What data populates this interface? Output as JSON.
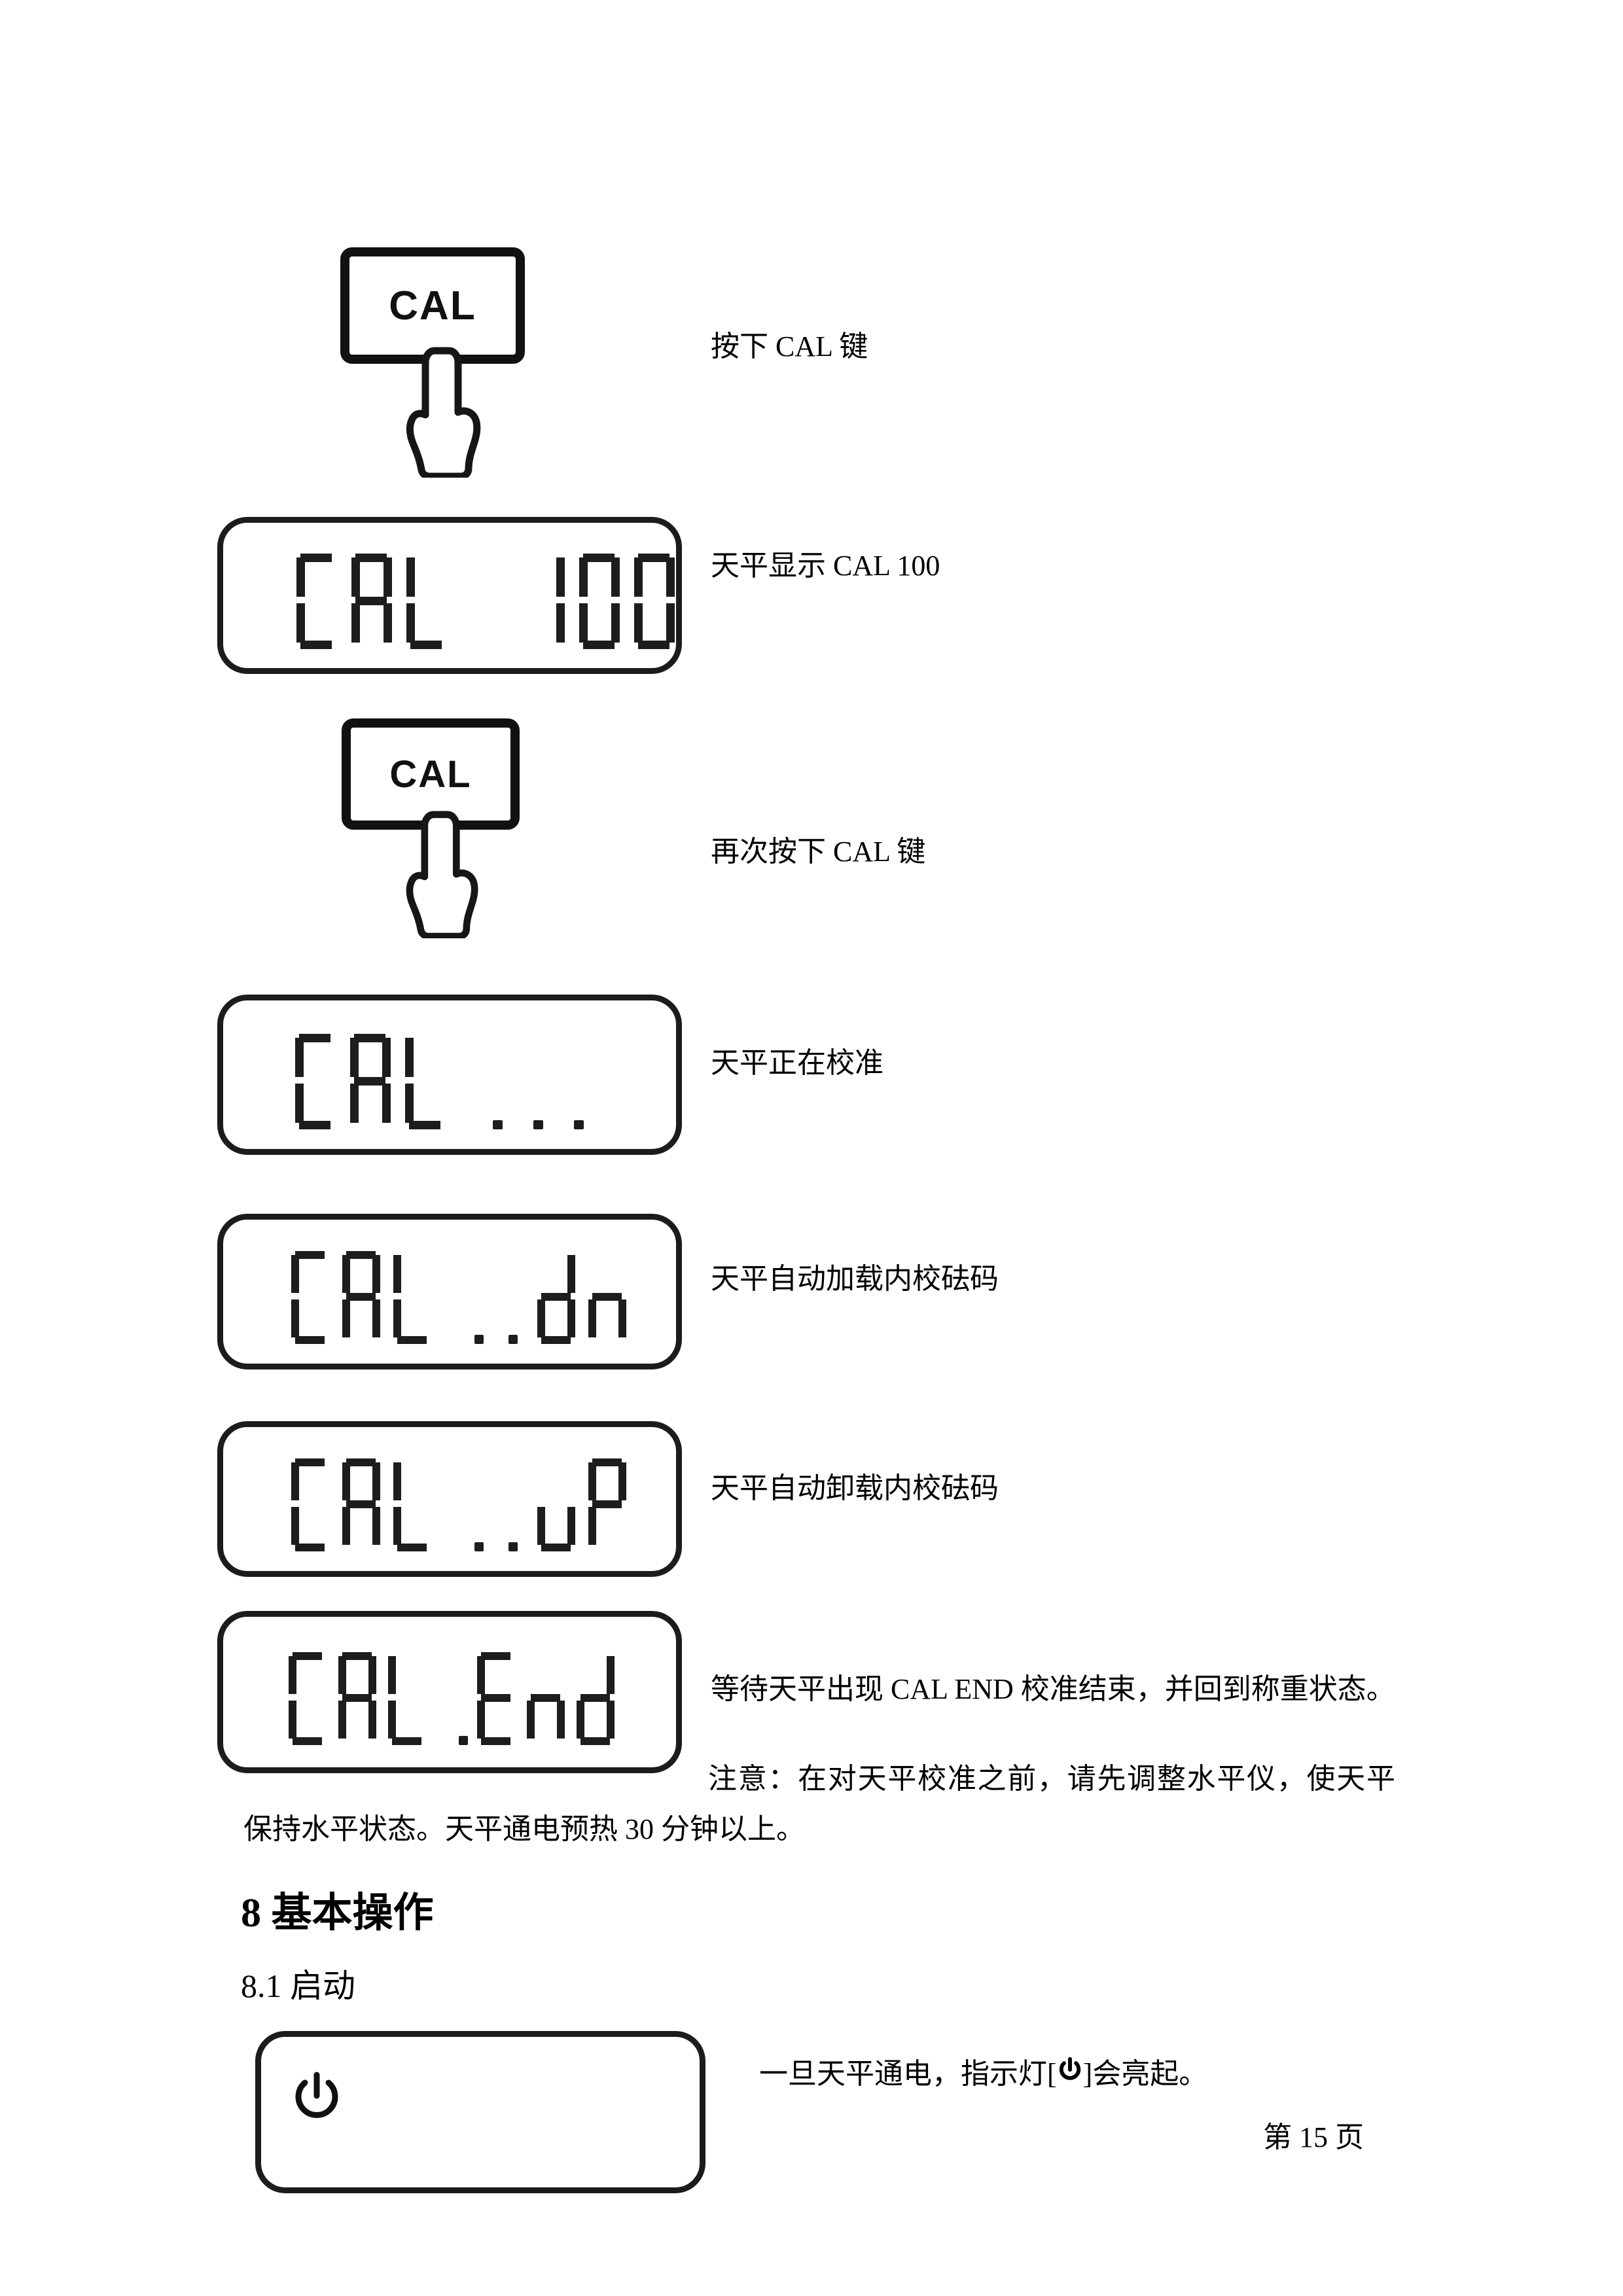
{
  "document": {
    "page_number_text": "第 15 页",
    "language": "zh-CN"
  },
  "steps": [
    {
      "id": "step-press-cal",
      "visual": "cal-key",
      "key_label": "CAL",
      "caption": "按下 CAL 键"
    },
    {
      "id": "step-display-cal-100",
      "visual": "lcd",
      "display_text": "CAL 100",
      "caption": "天平显示 CAL 100"
    },
    {
      "id": "step-press-cal-again",
      "visual": "cal-key",
      "key_label": "CAL",
      "caption": "再次按下 CAL 键"
    },
    {
      "id": "step-display-calibrating",
      "visual": "lcd",
      "display_text": "CAL ...",
      "caption": "天平正在校准"
    },
    {
      "id": "step-display-cal-dn",
      "visual": "lcd",
      "display_text": "CAL ..dn",
      "caption": "天平自动加载内校砝码"
    },
    {
      "id": "step-display-cal-up",
      "visual": "lcd",
      "display_text": "CAL ..uP",
      "caption": "天平自动卸载内校砝码"
    },
    {
      "id": "step-display-cal-end",
      "visual": "lcd",
      "display_text": "CAL .End",
      "caption": "等待天平出现 CAL END  校准结束，并回到称重状态。"
    }
  ],
  "note": {
    "text": "注意：在对天平校准之前，请先调整水平仪，使天平保持水平状态。天平通电预热 30 分钟以上。"
  },
  "sections": {
    "chapter": "8  基本操作",
    "subsection": "8.1  启动"
  },
  "startup": {
    "display_icon": "power-icon",
    "caption_before": "一旦天平通电，指示灯",
    "caption_bracket_open": "[",
    "caption_bracket_close": "]",
    "caption_after": "会亮起。"
  },
  "colors": {
    "ink": "#000000",
    "lcd_border": "#1c1c1c",
    "segment": "#1d1d1d",
    "key_border": "#111111",
    "page_background": "#ffffff"
  }
}
